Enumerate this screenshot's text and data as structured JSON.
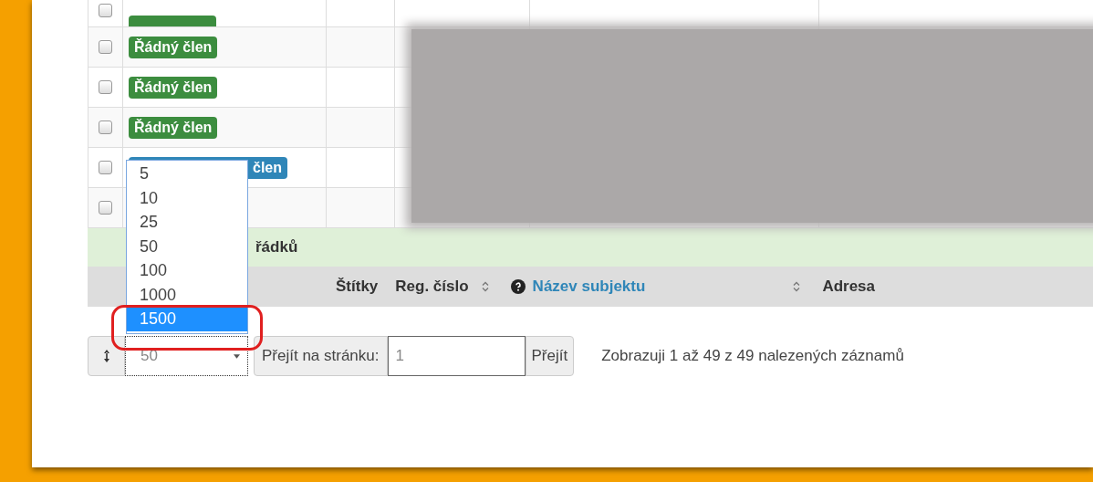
{
  "table": {
    "rows": [
      {
        "badge": {
          "kind": "stub"
        },
        "checked": false
      },
      {
        "badge": {
          "text": "Řádný člen",
          "kind": "green"
        },
        "checked": false
      },
      {
        "badge": {
          "text": "Řádný člen",
          "kind": "green"
        },
        "checked": false
      },
      {
        "badge": {
          "text": "Řádný člen",
          "kind": "green"
        },
        "checked": false
      },
      {
        "badge": {
          "text": "člen",
          "kind": "blue"
        },
        "checked": false
      },
      {
        "badge": null,
        "checked": false
      }
    ],
    "summary": "řádků",
    "header": [
      {
        "kind": "label",
        "text": "Štítky"
      },
      {
        "kind": "label",
        "text": "Reg. číslo"
      },
      {
        "kind": "sort"
      },
      {
        "kind": "help"
      },
      {
        "kind": "link",
        "text": "Název subjektu"
      },
      {
        "kind": "sort"
      },
      {
        "kind": "label",
        "text": "Adresa"
      }
    ]
  },
  "pagination": {
    "page_size": "50",
    "options": [
      {
        "label": "5",
        "selected": false
      },
      {
        "label": "10",
        "selected": false
      },
      {
        "label": "25",
        "selected": false
      },
      {
        "label": "50",
        "selected": false
      },
      {
        "label": "100",
        "selected": false
      },
      {
        "label": "1000",
        "selected": false
      },
      {
        "label": "1500",
        "selected": true
      }
    ],
    "goto_label": "Přejít na stránku:",
    "page_value": "1",
    "goto_button": "Přejít",
    "info": "Zobrazuji 1 až 49 z 49 nalezených záznamů"
  }
}
